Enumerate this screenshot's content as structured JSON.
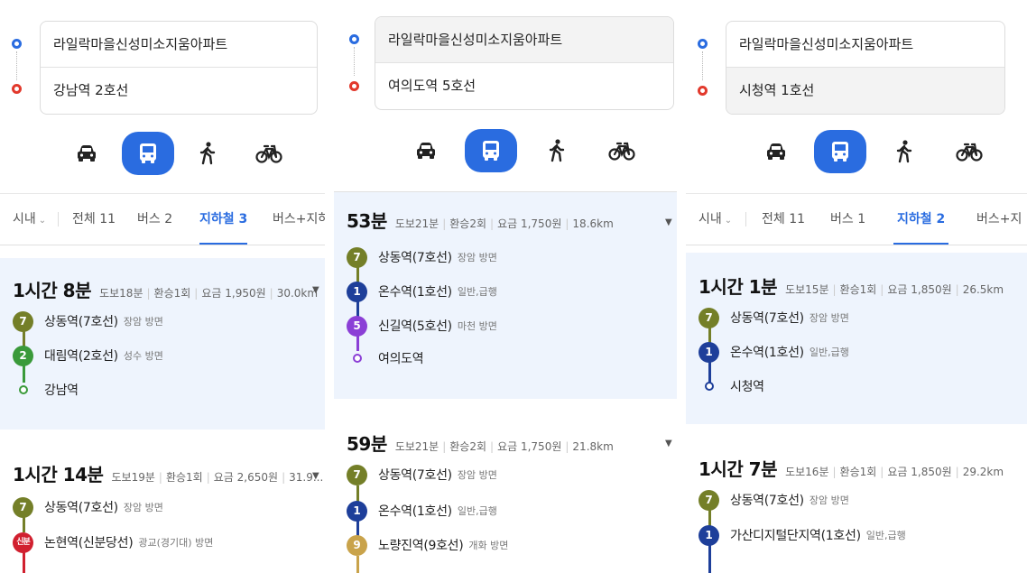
{
  "colors": {
    "accent": "#2a6ce0",
    "line7": "#747f28",
    "line2": "#3a9a3a",
    "line1": "#1e3f9a",
    "line5": "#8b3fd6",
    "line9": "#c9a34b",
    "sinbundang": "#d1202f",
    "selected_bg": "#eef4fd"
  },
  "panels": [
    {
      "origin": "라일락마을신성미소지움아파트",
      "destination": "강남역 2호선",
      "modes": [
        "car-icon",
        "bus-icon",
        "walk-icon",
        "bike-icon"
      ],
      "tabs": [
        {
          "label": "시내",
          "has_chevron": true
        },
        {
          "label": "전체 11"
        },
        {
          "label": "버스 2"
        },
        {
          "label": "지하철 3",
          "active": true
        },
        {
          "label": "버스+지하"
        }
      ],
      "routes": [
        {
          "time": "1시간 8분",
          "walk": "도보18분",
          "transfer": "환승1회",
          "fare": "요금 1,950원",
          "distance": "30.0km",
          "selected": true,
          "steps": [
            {
              "badge": "7",
              "color": "#747f28",
              "station": "상동역(7호선)",
              "direction": "장암 방면"
            },
            {
              "badge": "2",
              "color": "#3a9a3a",
              "station": "대림역(2호선)",
              "direction": "성수 방면"
            },
            {
              "badge": "",
              "color": "#3a9a3a",
              "station": "강남역",
              "direction": "",
              "ring": true
            }
          ]
        },
        {
          "time": "1시간 14분",
          "walk": "도보19분",
          "transfer": "환승1회",
          "fare": "요금 2,650원",
          "distance": "31.9...",
          "selected": false,
          "steps": [
            {
              "badge": "7",
              "color": "#747f28",
              "station": "상동역(7호선)",
              "direction": "장암 방면"
            },
            {
              "badge": "신분",
              "color": "#d1202f",
              "station": "논현역(신분당선)",
              "direction": "광교(경기대) 방면",
              "small": true
            }
          ]
        }
      ]
    },
    {
      "origin": "라일락마을신성미소지움아파트",
      "destination": "여의도역 5호선",
      "modes": [
        "car-icon",
        "bus-icon",
        "walk-icon",
        "bike-icon"
      ],
      "routes": [
        {
          "time": "53분",
          "walk": "도보21분",
          "transfer": "환승2회",
          "fare": "요금 1,750원",
          "distance": "18.6km",
          "selected": true,
          "steps": [
            {
              "badge": "7",
              "color": "#747f28",
              "station": "상동역(7호선)",
              "direction": "장암 방면"
            },
            {
              "badge": "1",
              "color": "#1e3f9a",
              "station": "온수역(1호선)",
              "direction": "일반,급행"
            },
            {
              "badge": "5",
              "color": "#8b3fd6",
              "station": "신길역(5호선)",
              "direction": "마천 방면"
            },
            {
              "badge": "",
              "color": "#8b3fd6",
              "station": "여의도역",
              "direction": "",
              "ring": true
            }
          ]
        },
        {
          "time": "59분",
          "walk": "도보21분",
          "transfer": "환승2회",
          "fare": "요금 1,750원",
          "distance": "21.8km",
          "selected": false,
          "steps": [
            {
              "badge": "7",
              "color": "#747f28",
              "station": "상동역(7호선)",
              "direction": "장암 방면"
            },
            {
              "badge": "1",
              "color": "#1e3f9a",
              "station": "온수역(1호선)",
              "direction": "일반,급행"
            },
            {
              "badge": "9",
              "color": "#c9a34b",
              "station": "노량진역(9호선)",
              "direction": "개화 방면"
            }
          ]
        }
      ]
    },
    {
      "origin": "라일락마을신성미소지움아파트",
      "destination": "시청역 1호선",
      "modes": [
        "car-icon",
        "bus-icon",
        "walk-icon",
        "bike-icon"
      ],
      "tabs": [
        {
          "label": "시내",
          "has_chevron": true
        },
        {
          "label": "전체 11"
        },
        {
          "label": "버스 1"
        },
        {
          "label": "지하철 2",
          "active": true
        },
        {
          "label": "버스+지"
        }
      ],
      "routes": [
        {
          "time": "1시간 1분",
          "walk": "도보15분",
          "transfer": "환승1회",
          "fare": "요금 1,850원",
          "distance": "26.5km",
          "selected": true,
          "steps": [
            {
              "badge": "7",
              "color": "#747f28",
              "station": "상동역(7호선)",
              "direction": "장암 방면"
            },
            {
              "badge": "1",
              "color": "#1e3f9a",
              "station": "온수역(1호선)",
              "direction": "일반,급행"
            },
            {
              "badge": "",
              "color": "#1e3f9a",
              "station": "시청역",
              "direction": "",
              "ring": true
            }
          ]
        },
        {
          "time": "1시간 7분",
          "walk": "도보16분",
          "transfer": "환승1회",
          "fare": "요금 1,850원",
          "distance": "29.2km",
          "selected": false,
          "steps": [
            {
              "badge": "7",
              "color": "#747f28",
              "station": "상동역(7호선)",
              "direction": "장암 방면"
            },
            {
              "badge": "1",
              "color": "#1e3f9a",
              "station": "가산디지털단지역(1호선)",
              "direction": "일반,급행"
            }
          ]
        }
      ]
    }
  ]
}
